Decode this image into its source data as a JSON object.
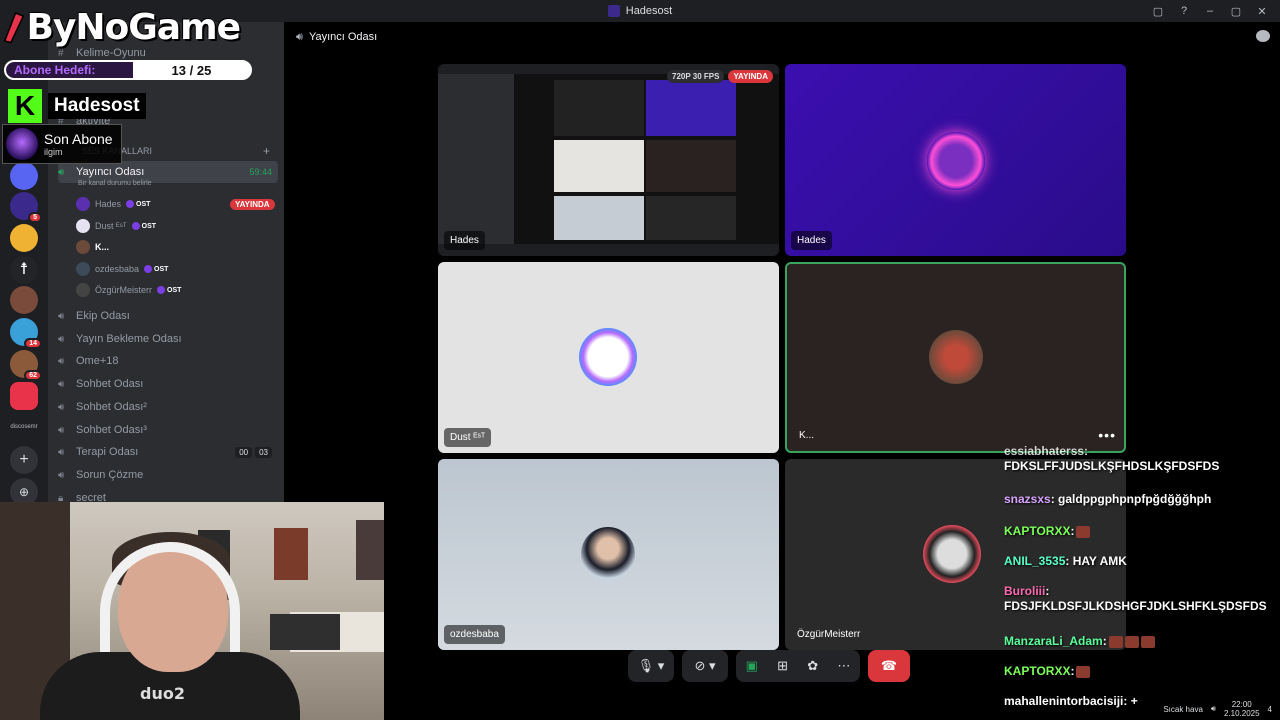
{
  "window": {
    "title": "Hadesost",
    "controls": [
      "▢",
      "?",
      "–",
      "▢",
      "✕"
    ]
  },
  "overlay": {
    "logo_text": "ByNoGame",
    "goal": {
      "label": "Abone Hedefi:",
      "current": 13,
      "target": 25,
      "value": "13 / 25"
    },
    "streamer_name": "Hadesost",
    "kick_letter": "K",
    "last_sub": {
      "title": "Son Abone",
      "subtitle": "ilgim"
    }
  },
  "sidebar": {
    "partial_top": "Kelime-Oyunu",
    "partial_2": "aktivite",
    "category": "SES KANALLARI",
    "active_channel": {
      "name": "Yayıncı Odası",
      "timer": "59:44",
      "status": "Bir kanal durumu belirle"
    },
    "users": [
      {
        "name": "Hades",
        "badge": "OST",
        "live": "YAYINDA",
        "color": "#5a2fb0"
      },
      {
        "name": "Dust ᴱˢᵀ",
        "badge": "OST",
        "color": "#e6e2f2"
      },
      {
        "name": "K...",
        "badge": "",
        "color": "#6b4a3b"
      },
      {
        "name": "ozdesbaba",
        "badge": "OST",
        "color": "#3c4a5a"
      },
      {
        "name": "ÖzgürMeisterr",
        "badge": "OST",
        "color": "#444"
      }
    ],
    "channels": [
      {
        "name": "Ekip Odası"
      },
      {
        "name": "Yayın Bekleme Odası"
      },
      {
        "name": "Ome+18"
      },
      {
        "name": "Sohbet Odası"
      },
      {
        "name": "Sohbet Odası²"
      },
      {
        "name": "Sohbet Odası³"
      },
      {
        "name": "Terapi Odası",
        "counts": [
          "00",
          "03"
        ]
      },
      {
        "name": "Sorun Çözme"
      },
      {
        "name": "secret"
      }
    ]
  },
  "rail": {
    "servers": [
      {
        "color": "#5865f2",
        "badge": ""
      },
      {
        "color": "#3b2a8c",
        "badge": "5"
      },
      {
        "color": "#f0b232",
        "badge": ""
      },
      {
        "color": "#232428",
        "badge": ""
      },
      {
        "color": "#7a4a3a",
        "badge": ""
      },
      {
        "color": "#3aa0d8",
        "badge": "14"
      },
      {
        "color": "#8b5a3a",
        "badge": "62"
      },
      {
        "color": "#e8334a",
        "badge": ""
      }
    ],
    "text_server": "discosemr"
  },
  "call": {
    "channel_title": "Yayıncı Odası",
    "stream_quality": "720P 30 FPS",
    "live": "YAYINDA",
    "tiles": [
      {
        "name": "Hades",
        "kind": "stream"
      },
      {
        "name": "Hades",
        "kind": "avatar"
      },
      {
        "name": "Dust ᴱˢᵀ",
        "kind": "avatar"
      },
      {
        "name": "K...",
        "kind": "avatar"
      },
      {
        "name": "ozdesbaba",
        "kind": "avatar"
      },
      {
        "name": "ÖzgürMeisterr",
        "kind": "avatar"
      }
    ],
    "more": "•••"
  },
  "chat": {
    "messages": [
      {
        "user": "essiabhaterss:",
        "text": "FDKSLFFJUDSLKŞFHDSLKŞFDSFDS",
        "color": "#ffffff"
      },
      {
        "user": "snazsxs",
        "text": ": galdppgphpnpfpğdğğğhph",
        "color": "#d8a3ff"
      },
      {
        "user": "KAPTORXX",
        "text": ":",
        "color": "#7cff5a"
      },
      {
        "user": "ANIL_3535",
        "text": ": HAY AMK",
        "color": "#5aff9a"
      },
      {
        "user": "Buroliii",
        "text": ":",
        "text2": "FDSJFKLDSFJLKDSHGFJDKLSHFKLŞDSFDS",
        "color": "#ff6ab0"
      },
      {
        "user": "ManzaraLi_Adam",
        "text": ":",
        "color": "#5aff9a"
      },
      {
        "user": "KAPTORXX",
        "text": ":",
        "color": "#7cff5a"
      },
      {
        "user": "mahallenintorbacisiji",
        "text": ": +",
        "color": "#ffffff"
      }
    ]
  },
  "webcam": {
    "shirt_text": "duo2"
  },
  "tray": {
    "time": "22:00",
    "date": "2.10.2025",
    "notif": "4",
    "weather": "Sıcak hava"
  }
}
